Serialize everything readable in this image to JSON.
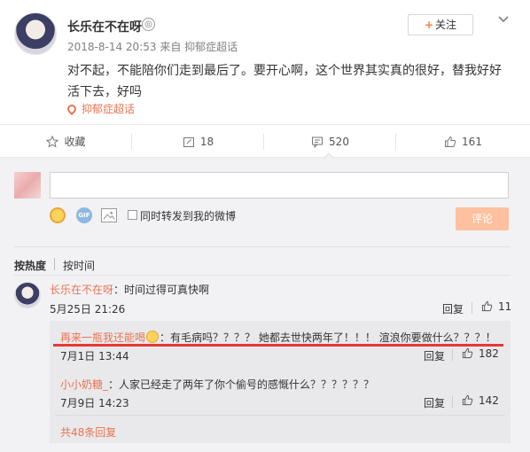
{
  "post": {
    "username": "长乐在不在呀",
    "vip_badge": "◎",
    "date": "2018-8-14 20:53",
    "source_prefix": "来自",
    "source": "抑郁症超话",
    "follow_plus": "+",
    "follow_label": "关注",
    "text": "对不起，不能陪你们走到最后了。要开心啊，这个世界其实真的很好，替我好好活下去，好吗",
    "topic": "抑郁症超话"
  },
  "actions": {
    "favorite": "收藏",
    "repost": "18",
    "comment": "520",
    "like": "161"
  },
  "composer": {
    "gif_label": "GIF",
    "forward_label": "同时转发到我的微博",
    "submit_label": "评论"
  },
  "sort": {
    "hot": "按热度",
    "time": "按时间"
  },
  "comments": [
    {
      "nick": "长乐在不在呀",
      "separator": "：",
      "text": "时间过得可真快啊",
      "time": "5月25日 21:26",
      "reply": "回复",
      "likes": "11"
    }
  ],
  "subreplies": [
    {
      "nick": "再来一瓶我还能喝",
      "separator": "：",
      "text": "有毛病吗？？？？ 她都去世快两年了！！！ 渲浪你要做什么？？？！",
      "time": "7月1日 13:44",
      "reply": "回复",
      "likes": "182"
    },
    {
      "nick": "小小奶糖_",
      "separator": "：",
      "text": "人家已经走了两年了你个偷号的感慨什么？？？？？？",
      "time": "7月9日 14:23",
      "reply": "回复",
      "likes": "142"
    }
  ],
  "more_replies": "共48条回复",
  "colors": {
    "accent": "#eb7350",
    "highlight_line": "#e53935",
    "submit_bg": "#ffc09f",
    "panel_bg": "#f2f2f5"
  }
}
